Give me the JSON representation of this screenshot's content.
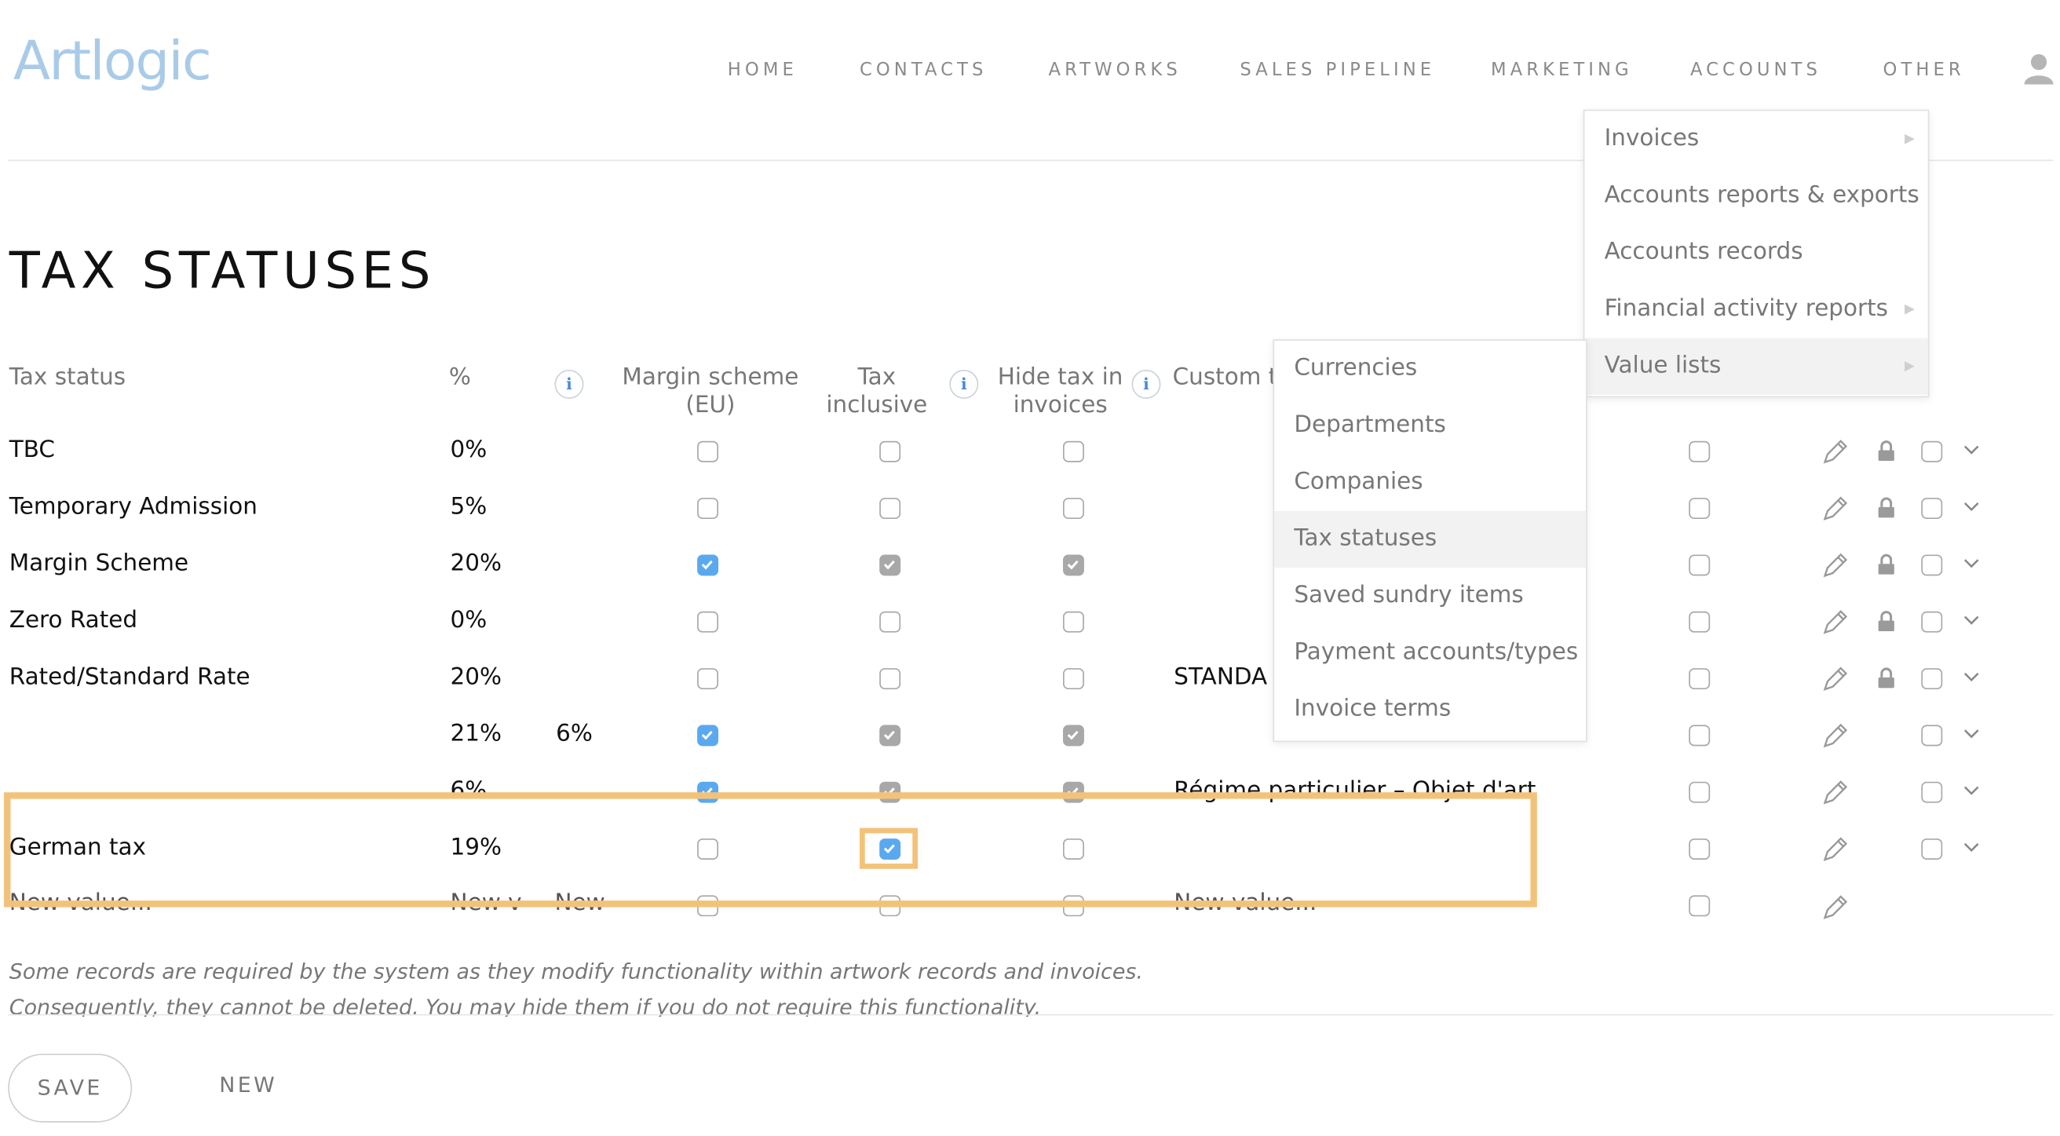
{
  "logo": "Artlogic",
  "nav": [
    "HOME",
    "CONTACTS",
    "ARTWORKS",
    "SALES PIPELINE",
    "MARKETING",
    "ACCOUNTS",
    "OTHER"
  ],
  "page_title": "TAX STATUSES",
  "columns": {
    "tax_status": "Tax status",
    "percent": "%",
    "margin_scheme": "Margin scheme (EU)",
    "tax_inclusive": "Tax inclusive",
    "hide_tax": "Hide tax in invoices",
    "custom": "Custom t",
    "info_glyph": "i"
  },
  "rows": [
    {
      "name": "TBC",
      "pct": "0%",
      "pct2": "",
      "custom": "",
      "margin": "off",
      "inclusive": "off",
      "hide": "off",
      "lock": true
    },
    {
      "name": "Temporary Admission",
      "pct": "5%",
      "pct2": "",
      "custom": "",
      "margin": "off",
      "inclusive": "off",
      "hide": "off",
      "lock": true
    },
    {
      "name": "Margin Scheme",
      "pct": "20%",
      "pct2": "",
      "custom": "",
      "margin": "blue",
      "inclusive": "gray",
      "hide": "gray",
      "lock": true
    },
    {
      "name": "Zero Rated",
      "pct": "0%",
      "pct2": "",
      "custom": "",
      "margin": "off",
      "inclusive": "off",
      "hide": "off",
      "lock": true
    },
    {
      "name": "Rated/Standard Rate",
      "pct": "20%",
      "pct2": "",
      "custom": "STANDA",
      "margin": "off",
      "inclusive": "off",
      "hide": "off",
      "lock": true
    },
    {
      "name": "",
      "pct": "21%",
      "pct2": "6%",
      "custom": "",
      "margin": "blue",
      "inclusive": "gray",
      "hide": "gray",
      "lock": false
    },
    {
      "name": "",
      "pct": "6%",
      "pct2": "",
      "custom": "Régime particulier – Objet d'art",
      "margin": "blue",
      "inclusive": "gray",
      "hide": "gray",
      "lock": false
    },
    {
      "name": "German tax",
      "pct": "19%",
      "pct2": "",
      "custom": "",
      "margin": "off",
      "inclusive": "blue",
      "hide": "off",
      "lock": false
    }
  ],
  "new_row": {
    "name": "New value...",
    "pct": "New v",
    "pct2": "New",
    "custom": "New value..."
  },
  "note": "Some records are required by the system as they modify functionality within artwork records and invoices. Consequently, they cannot be deleted. You may hide them if you do not require this functionality.",
  "buttons": {
    "save": "SAVE",
    "new": "NEW"
  },
  "accounts_menu": [
    {
      "label": "Invoices",
      "arrow": true
    },
    {
      "label": "Accounts reports & exports",
      "arrow": false
    },
    {
      "label": "Accounts records",
      "arrow": false
    },
    {
      "label": "Financial activity reports",
      "arrow": true
    },
    {
      "label": "Value lists",
      "arrow": true
    }
  ],
  "value_lists_menu": [
    "Currencies",
    "Departments",
    "Companies",
    "Tax statuses",
    "Saved sundry items",
    "Payment accounts/types",
    "Invoice terms"
  ],
  "value_lists_selected": "Tax statuses",
  "colors": {
    "accent_blue": "#5aa9f0",
    "highlight": "#f3c27a",
    "logo": "#a9cbe8"
  }
}
